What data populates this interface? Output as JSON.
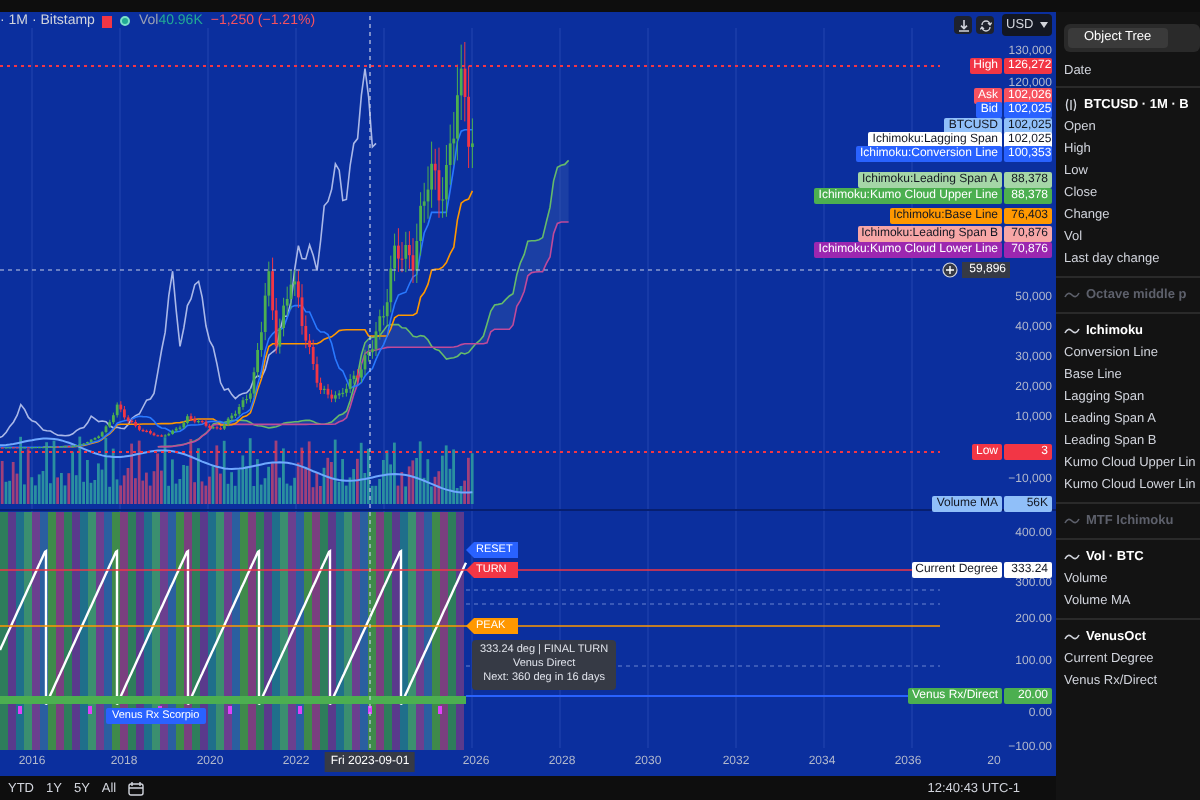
{
  "header": {
    "symbol": "· 1M · Bitstamp",
    "market_open": true,
    "volume_label": "Vol",
    "volume_value": "40.96K",
    "change": "−1,250 (−1.21%)"
  },
  "currency": "USD",
  "price_ticks": [
    "130,000",
    "120,000",
    "50,000",
    "40,000",
    "30,000",
    "20,000",
    "10,000",
    "−10,000",
    "400.00",
    "300.00",
    "200.00",
    "100.00",
    "0.00",
    "−100.00"
  ],
  "price_tags": [
    {
      "label": "High",
      "value": "126,272",
      "color": "#f23645"
    },
    {
      "label": "Ask",
      "value": "102,026",
      "color": "#f7525f"
    },
    {
      "label": "Bid",
      "value": "102,025",
      "color": "#2962ff"
    },
    {
      "label": "BTCUSD",
      "value": "102,025",
      "color": "#90bff9"
    },
    {
      "label": "Ichimoku:Lagging Span",
      "value": "102,025",
      "color": "#ffffff"
    },
    {
      "label": "Ichimoku:Conversion Line",
      "value": "100,353",
      "color": "#2962ff"
    },
    {
      "label": "Ichimoku:Leading Span A",
      "value": "88,378",
      "color": "#a5d6a7"
    },
    {
      "label": "Ichimoku:Kumo Cloud Upper Line",
      "value": "88,378",
      "color": "#4caf50"
    },
    {
      "label": "Ichimoku:Base Line",
      "value": "76,403",
      "color": "#ff9800"
    },
    {
      "label": "Ichimoku:Leading Span B",
      "value": "70,876",
      "color": "#f7a6a6"
    },
    {
      "label": "Ichimoku:Kumo Cloud Lower Line",
      "value": "70,876",
      "color": "#9c27b0"
    },
    {
      "label": "Low",
      "value": "3",
      "color": "#f23645"
    },
    {
      "label": "Volume MA",
      "value": "56K",
      "color": "#90bff9"
    },
    {
      "label": "Current Degree",
      "value": "333.24",
      "color": "#ffffff"
    },
    {
      "label": "Venus Rx/Direct",
      "value": "20.00",
      "color": "#4caf50"
    }
  ],
  "crosshair": {
    "price": "59,896",
    "date": "Fri 2023-09-01"
  },
  "markers": [
    {
      "label": "RESET",
      "color": "#2962ff"
    },
    {
      "label": "TURN",
      "color": "#f23645"
    },
    {
      "label": "PEAK",
      "color": "#ff9800"
    }
  ],
  "tooltip": [
    "333.24 deg | FINAL TURN",
    "Venus Direct",
    "Next: 360 deg in 16 days"
  ],
  "event_label": "Venus Rx Scorpio",
  "time_axis": [
    "2016",
    "2018",
    "2020",
    "2022",
    "2026",
    "2028",
    "2030",
    "2032",
    "2034",
    "2036",
    "20"
  ],
  "ranges": [
    "YTD",
    "1Y",
    "5Y",
    "All"
  ],
  "clock": "12:40:43 UTC-1",
  "panel": {
    "tabs": [
      {
        "label": "Object Tree",
        "selected": true
      }
    ],
    "date_label": "Date",
    "sections": [
      {
        "title": "BTCUSD · 1M · B",
        "kind": "symbol",
        "hidden": false,
        "rows": [
          "Open",
          "High",
          "Low",
          "Close",
          "Change",
          "Vol",
          "Last day change"
        ]
      },
      {
        "title": "Octave middle p",
        "kind": "indicator",
        "hidden": true
      },
      {
        "title": "Ichimoku",
        "kind": "indicator",
        "hidden": false,
        "rows": [
          "Conversion Line",
          "Base Line",
          "Lagging Span",
          "Leading Span A",
          "Leading Span B",
          "Kumo Cloud Upper Lin",
          "Kumo Cloud Lower Lin"
        ]
      },
      {
        "title": "MTF Ichimoku",
        "kind": "indicator",
        "hidden": true
      },
      {
        "title": "Vol · BTC",
        "kind": "indicator",
        "hidden": false,
        "rows": [
          "Volume",
          "Volume MA"
        ]
      },
      {
        "title": "VenusOct",
        "kind": "indicator",
        "hidden": false,
        "rows": [
          "Current Degree",
          "Venus Rx/Direct"
        ]
      }
    ]
  }
}
